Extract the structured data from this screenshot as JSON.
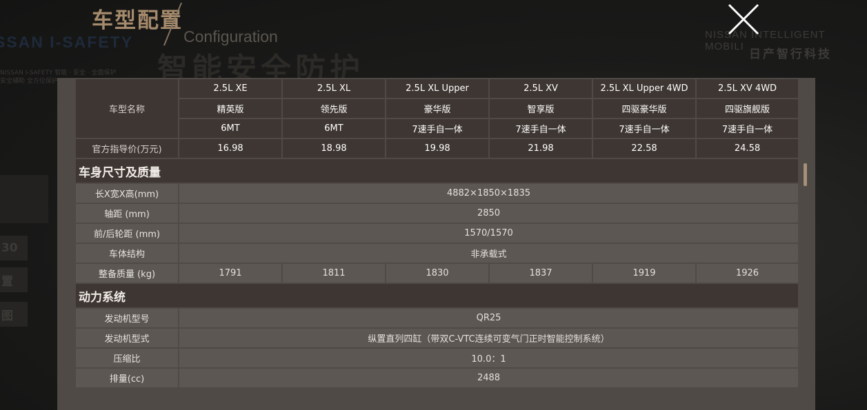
{
  "background": {
    "title_cn": "车型配置",
    "title_en": "Configuration",
    "big_heading": "智能安全防护",
    "safety_text": "SSAN I-SAFETY",
    "small_lines": [
      "NISSAN I-SAFETY 智能 · 安全 · 全面保护",
      "安全辅助 全方位保护"
    ],
    "brand_en": "NISSAN INTELLIGENT MOBILI",
    "brand_cn": "日产智行科技",
    "side_buttons": [
      "30",
      "置",
      "图"
    ]
  },
  "close_icon": "close-icon",
  "spec": {
    "model_label": "车型名称",
    "price_label": "官方指导价(万元)",
    "models": [
      {
        "name": "2.5L XE",
        "edition": "精英版",
        "transmission": "6MT",
        "price": "16.98"
      },
      {
        "name": "2.5L XL",
        "edition": "领先版",
        "transmission": "6MT",
        "price": "18.98"
      },
      {
        "name": "2.5L XL Upper",
        "edition": "豪华版",
        "transmission": "7速手自一体",
        "price": "19.98"
      },
      {
        "name": "2.5L XV",
        "edition": "智享版",
        "transmission": "7速手自一体",
        "price": "21.98"
      },
      {
        "name": "2.5L XL Upper 4WD",
        "edition": "四驱豪华版",
        "transmission": "7速手自一体",
        "price": "22.58"
      },
      {
        "name": "2.5L XV 4WD",
        "edition": "四驱旗舰版",
        "transmission": "7速手自一体",
        "price": "24.58"
      }
    ],
    "sections": [
      {
        "title": "车身尺寸及质量",
        "rows": [
          {
            "label": "长X宽X高(mm)",
            "value": "4882×1850×1835"
          },
          {
            "label": "轴距 (mm)",
            "value": "2850"
          },
          {
            "label": "前/后轮距 (mm)",
            "value": "1570/1570"
          },
          {
            "label": "车体结构",
            "value": "非承载式"
          },
          {
            "label": "整备质量 (kg)",
            "values": [
              "1791",
              "1811",
              "1830",
              "1837",
              "1919",
              "1926"
            ]
          }
        ]
      },
      {
        "title": "动力系统",
        "rows": [
          {
            "label": "发动机型号",
            "value": "QR25"
          },
          {
            "label": "发动机型式",
            "value": "纵置直列四缸（带双C-VTC连续可变气门正时智能控制系统）"
          },
          {
            "label": "压缩比",
            "value": "10.0：1"
          },
          {
            "label": "排量(cc)",
            "value": "2488"
          }
        ]
      }
    ]
  },
  "colors": {
    "accent": "#a58a6c",
    "header_bg": "#3e3632",
    "row_bg": "#5c5753",
    "modal_bg": "#4f4a46"
  }
}
